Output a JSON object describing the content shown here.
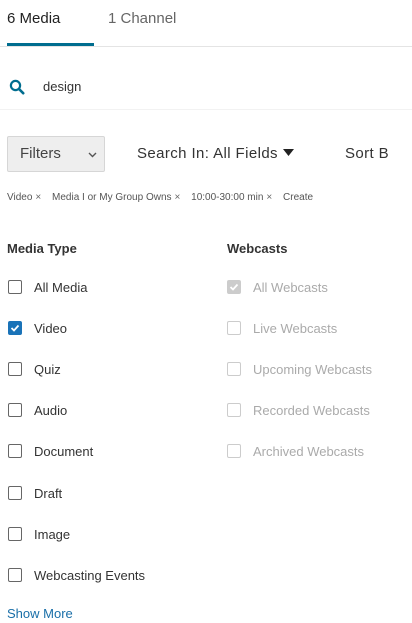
{
  "tabs": [
    {
      "label": "6 Media",
      "active": true
    },
    {
      "label": "1 Channel",
      "active": false
    }
  ],
  "search": {
    "value": "design",
    "icon": "search-icon"
  },
  "toolbar": {
    "filters_label": "Filters",
    "search_in_label": "Search In: All Fields",
    "sort_label": "Sort B"
  },
  "chips": [
    {
      "label": "Video"
    },
    {
      "label": "Media I or My Group Owns"
    },
    {
      "label": "10:00-30:00 min"
    },
    {
      "label": "Create"
    }
  ],
  "chip_remove_glyph": "×",
  "media_type": {
    "heading": "Media Type",
    "options": [
      {
        "label": "All Media",
        "checked": false
      },
      {
        "label": "Video",
        "checked": true
      },
      {
        "label": "Quiz",
        "checked": false
      },
      {
        "label": "Audio",
        "checked": false
      },
      {
        "label": "Document",
        "checked": false
      },
      {
        "label": "Draft",
        "checked": false
      },
      {
        "label": "Image",
        "checked": false
      },
      {
        "label": "Webcasting Events",
        "checked": false
      }
    ]
  },
  "webcasts": {
    "heading": "Webcasts",
    "options": [
      {
        "label": "All Webcasts",
        "checked": true,
        "disabled": true
      },
      {
        "label": "Live Webcasts",
        "checked": false,
        "disabled": true
      },
      {
        "label": "Upcoming Webcasts",
        "checked": false,
        "disabled": true
      },
      {
        "label": "Recorded Webcasts",
        "checked": false,
        "disabled": true
      },
      {
        "label": "Archived Webcasts",
        "checked": false,
        "disabled": true
      }
    ]
  },
  "show_more_label": "Show More",
  "colors": {
    "accent": "#006d8f",
    "checkbox_checked": "#1a73b8",
    "link": "#1a6fa8",
    "disabled": "#aaaaaa"
  }
}
